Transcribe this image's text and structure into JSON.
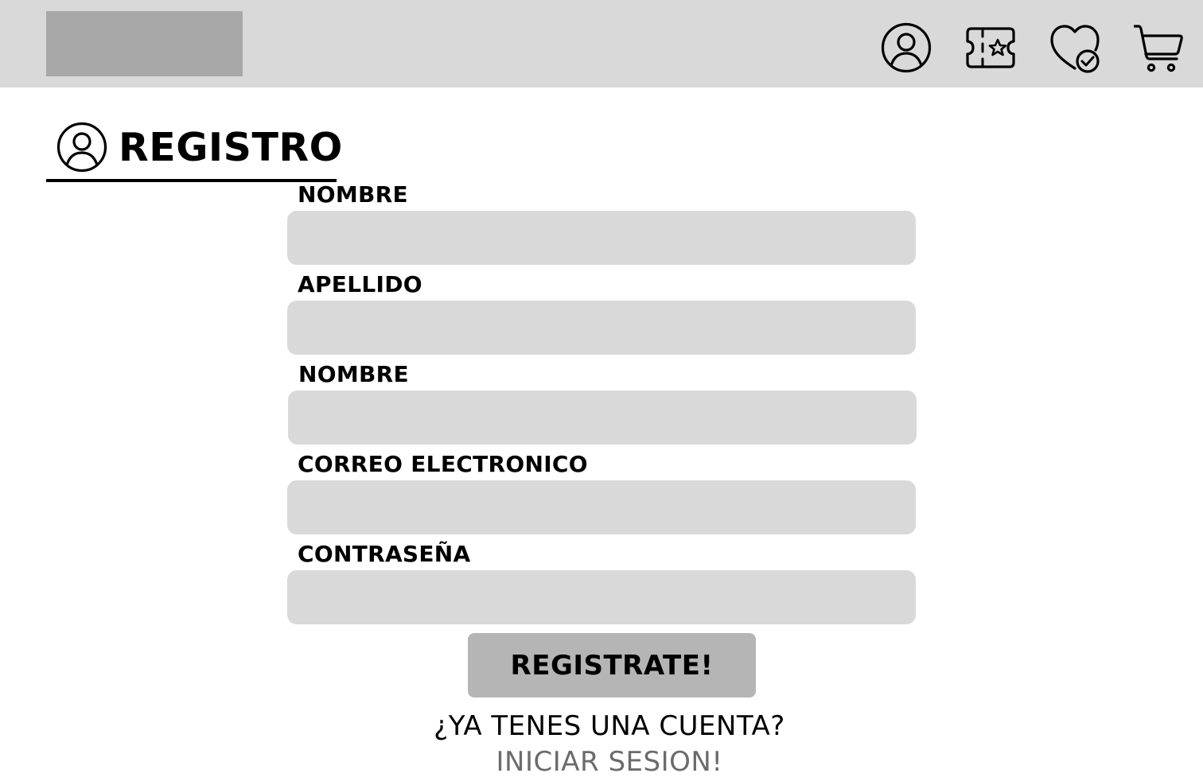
{
  "header": {
    "icons": [
      "user-icon",
      "ticket-icon",
      "heart-check-icon",
      "cart-icon"
    ]
  },
  "registro": {
    "title": "REGISTRO",
    "icon": "user-icon"
  },
  "form": {
    "fields": [
      {
        "label": "NOMBRE",
        "value": ""
      },
      {
        "label": "APELLIDO",
        "value": ""
      },
      {
        "label": "NOMBRE",
        "value": ""
      },
      {
        "label": "CORREO ELECTRONICO",
        "value": ""
      },
      {
        "label": "CONTRASEÑA",
        "value": ""
      }
    ],
    "submit_label": "REGISTRATE!",
    "account_question": "¿YA TENES UNA CUENTA?",
    "login_link": "INICIAR SESION!"
  },
  "colors": {
    "header_bg": "#d9d9d9",
    "logo_placeholder": "#a8a8a8",
    "input_bg": "#d9d9d9",
    "button_bg": "#b5b5b5",
    "link_color": "#6b6b6b"
  }
}
